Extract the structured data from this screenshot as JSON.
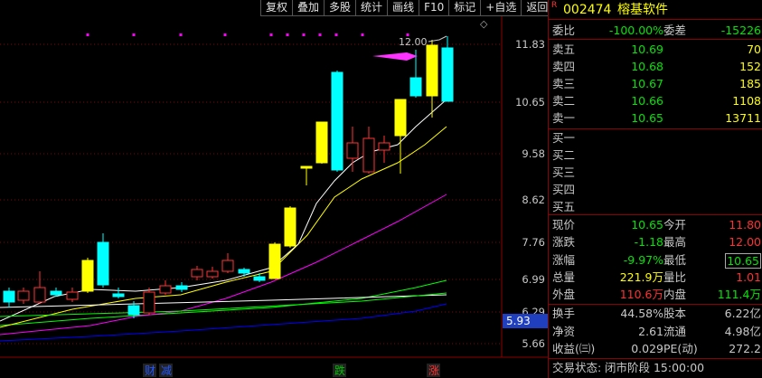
{
  "toolbar": [
    "复权",
    "叠加",
    "多股",
    "统计",
    "画线",
    "F10",
    "标记",
    "+自选",
    "返回"
  ],
  "chart": {
    "max_label": "12.00",
    "price_axis": [
      "11.83",
      "10.65",
      "9.58",
      "8.62",
      "7.76",
      "6.99",
      "6.29",
      "5.66"
    ],
    "current_price_tag": "5.93",
    "events": [
      "财",
      "减",
      "跌",
      "涨"
    ],
    "colors": {
      "up": "#ff3232",
      "down": "#00ffff",
      "limit_up": "#ffff00",
      "ma5": "#ffffff",
      "ma10": "#ffff00",
      "ma20": "#ff00ff",
      "ma60": "#00ff00",
      "ma120": "#0000ff"
    }
  },
  "quote": {
    "code": "002474",
    "name": "榕基软件",
    "badge": "R",
    "weibi_label": "委比",
    "weibi": "-100.00%",
    "weicha_label": "委差",
    "weicha": "-15226",
    "asks": [
      {
        "label": "卖五",
        "price": "10.69",
        "vol": "70"
      },
      {
        "label": "卖四",
        "price": "10.68",
        "vol": "152"
      },
      {
        "label": "卖三",
        "price": "10.67",
        "vol": "185"
      },
      {
        "label": "卖二",
        "price": "10.66",
        "vol": "1108"
      },
      {
        "label": "卖一",
        "price": "10.65",
        "vol": "13711"
      }
    ],
    "bids": [
      {
        "label": "买一"
      },
      {
        "label": "买二"
      },
      {
        "label": "买三"
      },
      {
        "label": "买四"
      },
      {
        "label": "买五"
      }
    ],
    "stats": [
      {
        "l1": "现价",
        "v1": "10.65",
        "l2": "今开",
        "v2": "11.80"
      },
      {
        "l1": "涨跌",
        "v1": "-1.18",
        "l2": "最高",
        "v2": "12.00"
      },
      {
        "l1": "涨幅",
        "v1": "-9.97%",
        "l2": "最低",
        "v2": "10.65"
      },
      {
        "l1": "总量",
        "v1": "221.9万",
        "l2": "量比",
        "v2": "1.01"
      },
      {
        "l1": "外盘",
        "v1": "110.6万",
        "l2": "内盘",
        "v2": "111.4万"
      }
    ],
    "fund": [
      {
        "l1": "换手",
        "v1": "44.58%",
        "l2": "股本",
        "v2": "6.22亿"
      },
      {
        "l1": "净资",
        "v1": "2.61",
        "l2": "流通",
        "v2": "4.98亿"
      },
      {
        "l1": "收益(㈢)",
        "v1": "0.029",
        "l2": "PE(动)",
        "v2": "272.2"
      }
    ],
    "trade_status_label": "交易状态:",
    "trade_status": "闭市阶段 15:00:00"
  }
}
